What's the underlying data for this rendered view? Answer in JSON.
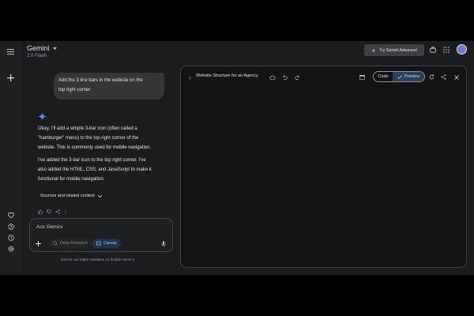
{
  "header": {
    "app_name": "Gemini",
    "model": "2.0 Flash",
    "try_advanced_label": "Try Gemini Advanced"
  },
  "chat": {
    "user_message_line1": "Add the 3 line bars in the webiste on the",
    "user_message_line2": "top right corner",
    "reply_p1_lines": [
      "Okay, I'll add a simple 3-bar icon (often called a",
      "\"hamburger\" menu) to the top right corner of the",
      "website. This is commonly used for mobile navigation."
    ],
    "reply_p2_lines": [
      "I've added the 3-bar icon to the top right corner.  I've",
      "also added the HTML, CSS, and JavaScript to make it",
      "functional for mobile navigation."
    ],
    "sources_label": "Sources and related content"
  },
  "input": {
    "placeholder": "Ask Gemini",
    "deep_research_label": "Deep Research",
    "canvas_label": "Canvas",
    "disclaimer": "Gemini can make mistakes, so double-check it"
  },
  "canvas": {
    "title": "Website Structure for an Agency",
    "code_label": "Code",
    "preview_label": "Preview"
  },
  "colors": {
    "background": "#1b1c1d",
    "accent_blue": "#4e8cf5",
    "preview_active": "#2c3e5a"
  },
  "icons": [
    "menu-icon",
    "plus-icon",
    "chevron-down-icon",
    "gem-icon",
    "grid-icon",
    "avatar",
    "close-icon",
    "refresh-icon",
    "share-icon",
    "undo-icon",
    "redo-icon",
    "cloud-icon",
    "mic-icon",
    "thumbs-up-icon",
    "thumbs-down-icon",
    "gear-icon",
    "history-icon",
    "help-icon",
    "heart-icon",
    "check-icon",
    "sparkle-icon"
  ]
}
